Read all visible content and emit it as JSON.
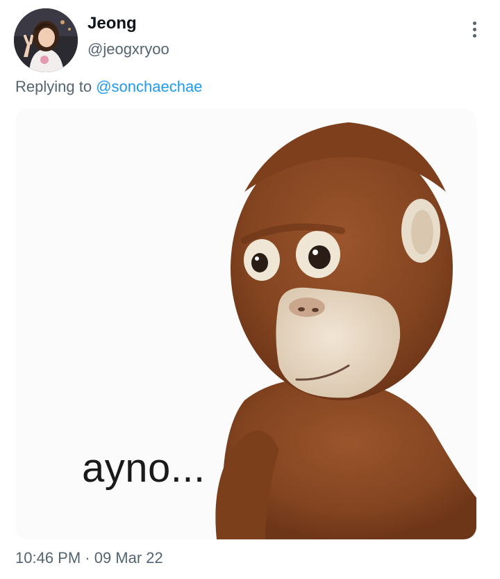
{
  "author": {
    "display_name": "Jeong",
    "handle": "@jeogxryoo"
  },
  "reply": {
    "prefix": "Replying to",
    "mention": "@sonchaechae"
  },
  "media": {
    "caption": "ayno..."
  },
  "meta": {
    "timestamp": "10:46 PM · 09 Mar 22"
  },
  "colors": {
    "link": "#1d9bf0",
    "secondary_text": "#536471",
    "fur": "#8a4a26",
    "face": "#eadbc6"
  },
  "icons": {
    "more": "more-vertical-icon"
  }
}
